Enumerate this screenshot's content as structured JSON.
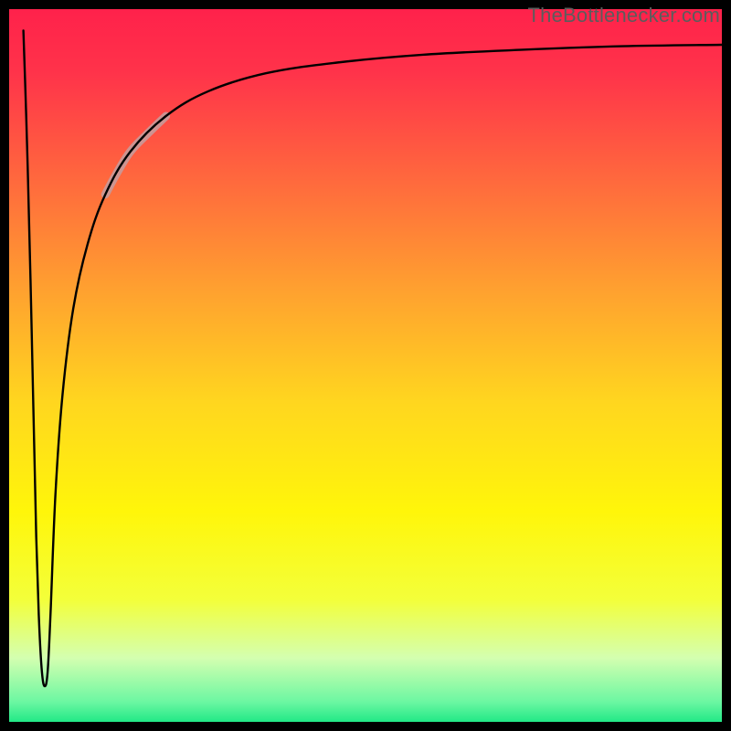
{
  "watermark": "TheBottleneсker.com",
  "chart_data": {
    "type": "line",
    "title": "",
    "xlabel": "",
    "ylabel": "",
    "xlim": [
      0,
      100
    ],
    "ylim": [
      0,
      100
    ],
    "background_gradient": {
      "stops": [
        {
          "offset": 0.0,
          "color": "#ff1f4b"
        },
        {
          "offset": 0.1,
          "color": "#ff334a"
        },
        {
          "offset": 0.25,
          "color": "#ff6a3d"
        },
        {
          "offset": 0.4,
          "color": "#ffa22f"
        },
        {
          "offset": 0.55,
          "color": "#ffd61f"
        },
        {
          "offset": 0.7,
          "color": "#fff60a"
        },
        {
          "offset": 0.82,
          "color": "#f3ff3a"
        },
        {
          "offset": 0.9,
          "color": "#d4ffb0"
        },
        {
          "offset": 0.96,
          "color": "#6cf7a2"
        },
        {
          "offset": 1.0,
          "color": "#00e27a"
        }
      ]
    },
    "series": [
      {
        "name": "curve",
        "color": "#000000",
        "width": 2.4,
        "points": [
          {
            "x": 2.0,
            "y": 97.0
          },
          {
            "x": 2.3,
            "y": 88.0
          },
          {
            "x": 2.6,
            "y": 78.0
          },
          {
            "x": 3.0,
            "y": 62.0
          },
          {
            "x": 3.4,
            "y": 44.0
          },
          {
            "x": 3.8,
            "y": 26.0
          },
          {
            "x": 4.2,
            "y": 14.0
          },
          {
            "x": 4.6,
            "y": 7.0
          },
          {
            "x": 5.0,
            "y": 5.0
          },
          {
            "x": 5.4,
            "y": 7.0
          },
          {
            "x": 5.8,
            "y": 15.0
          },
          {
            "x": 6.5,
            "y": 32.0
          },
          {
            "x": 7.5,
            "y": 46.0
          },
          {
            "x": 9.0,
            "y": 58.0
          },
          {
            "x": 11.0,
            "y": 67.0
          },
          {
            "x": 13.5,
            "y": 74.0
          },
          {
            "x": 17.0,
            "y": 80.0
          },
          {
            "x": 22.0,
            "y": 85.0
          },
          {
            "x": 28.0,
            "y": 88.5
          },
          {
            "x": 36.0,
            "y": 91.0
          },
          {
            "x": 46.0,
            "y": 92.5
          },
          {
            "x": 58.0,
            "y": 93.6
          },
          {
            "x": 72.0,
            "y": 94.3
          },
          {
            "x": 86.0,
            "y": 94.8
          },
          {
            "x": 100.0,
            "y": 95.0
          }
        ]
      },
      {
        "name": "highlight-segment",
        "color": "#c89a9a",
        "width": 9,
        "opacity": 0.9,
        "points": [
          {
            "x": 13.5,
            "y": 74.0
          },
          {
            "x": 15.0,
            "y": 76.8
          },
          {
            "x": 17.0,
            "y": 80.0
          },
          {
            "x": 19.5,
            "y": 82.6
          },
          {
            "x": 22.0,
            "y": 85.0
          }
        ]
      }
    ],
    "frame": {
      "stroke": "#000000",
      "stroke_width": 10
    }
  }
}
